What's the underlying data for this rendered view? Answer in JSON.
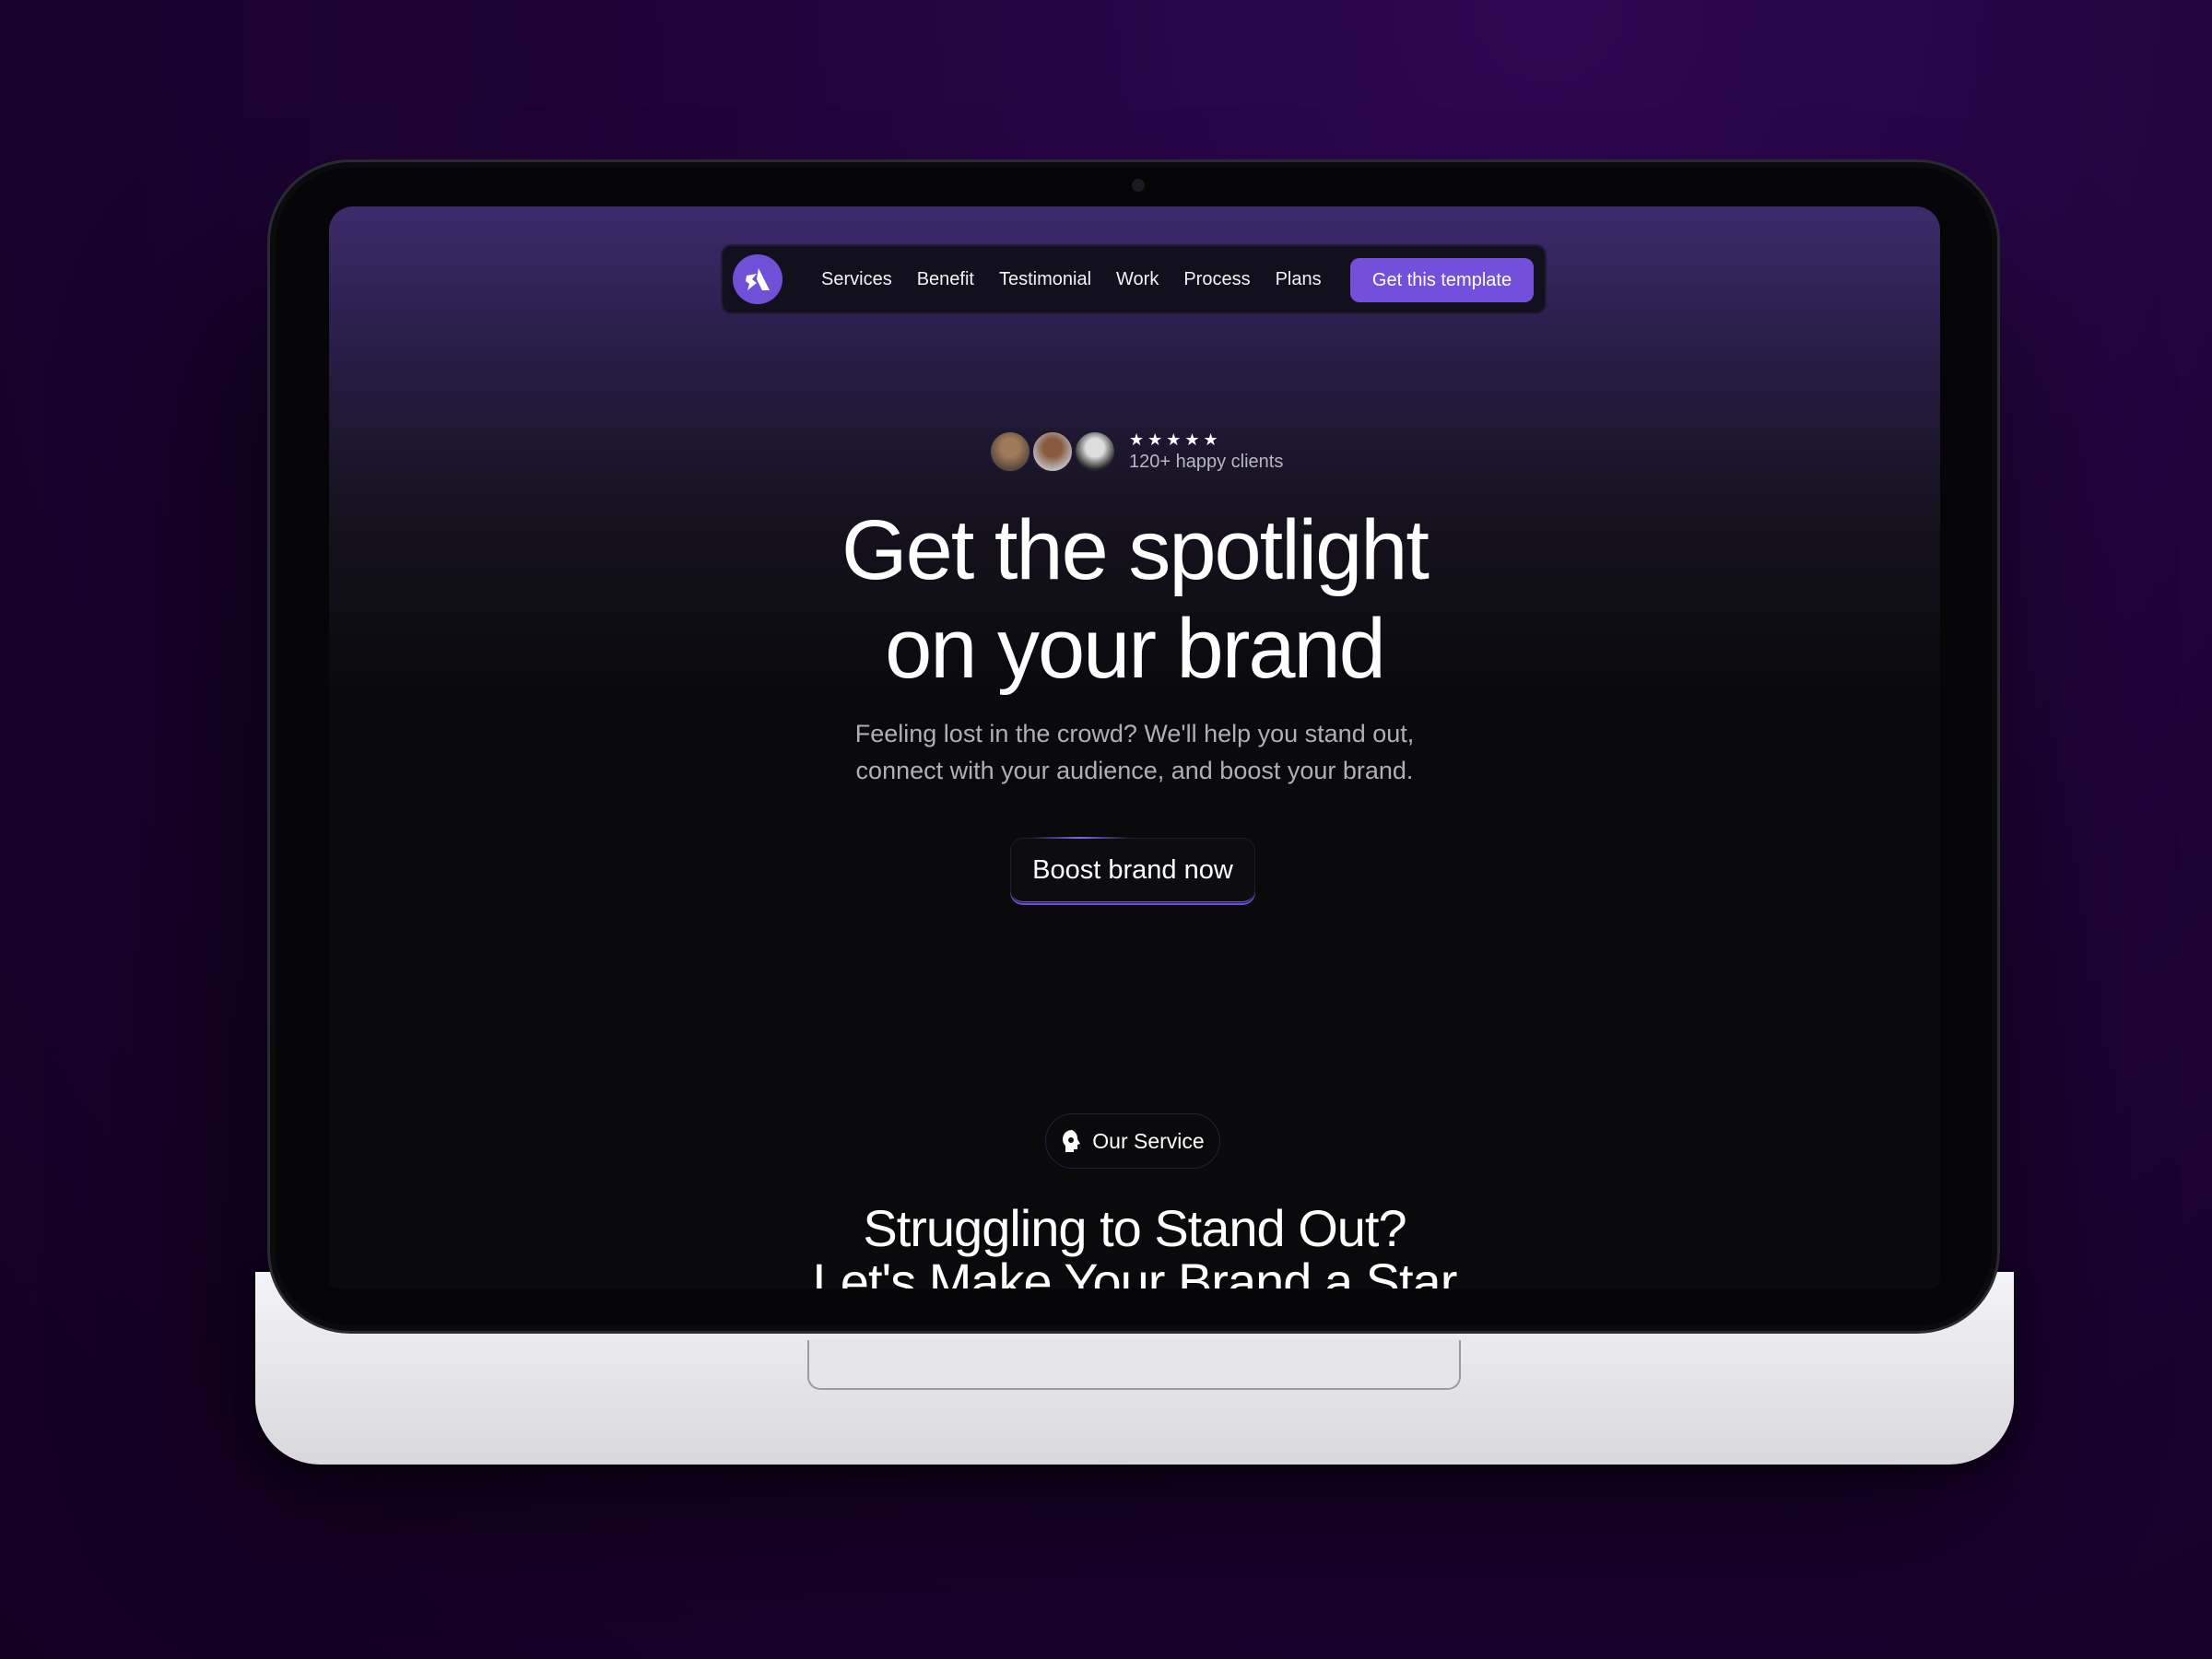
{
  "nav": {
    "links": [
      "Services",
      "Benefit",
      "Testimonial",
      "Work",
      "Process",
      "Plans"
    ],
    "cta_label": "Get this template",
    "logo_icon": "brand-logo-icon"
  },
  "hero": {
    "rating_stars": "★★★★★",
    "rating": 5,
    "clients_text": "120+ happy clients",
    "title_line1": "Get the spotlight",
    "title_line2": "on your brand",
    "subtitle_line1": "Feeling lost in the crowd? We'll help you stand out,",
    "subtitle_line2": "connect with your audience, and boost your brand.",
    "button_label": "Boost brand now"
  },
  "services": {
    "badge_label": "Our Service",
    "badge_icon": "headset-person-icon",
    "heading_line1": "Struggling to Stand Out?",
    "heading_line2": "Let's Make Your Brand a Star"
  },
  "colors": {
    "accent": "#7350dc",
    "background": "#0a0a0c",
    "page_bg": "#1d0336"
  }
}
